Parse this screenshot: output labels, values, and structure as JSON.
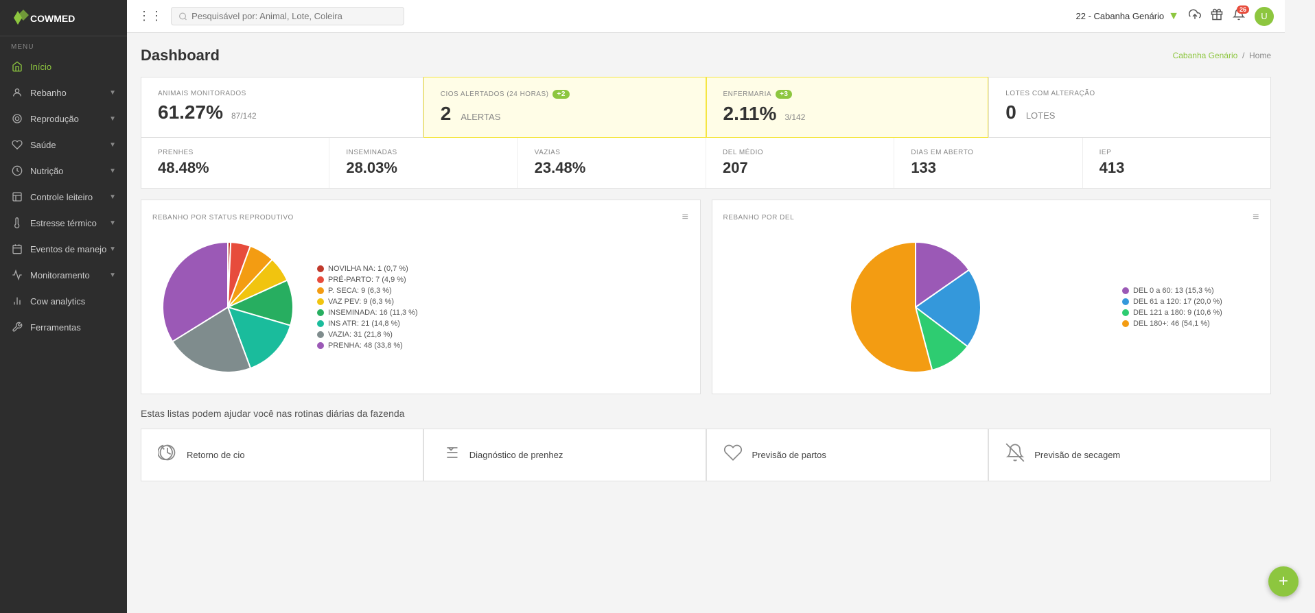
{
  "sidebar": {
    "logo_text": "COWMED",
    "menu_label": "Menu",
    "items": [
      {
        "id": "inicio",
        "label": "Início",
        "icon": "home",
        "active": true,
        "has_children": false
      },
      {
        "id": "rebanho",
        "label": "Rebanho",
        "icon": "cow",
        "active": false,
        "has_children": true
      },
      {
        "id": "reproducao",
        "label": "Reprodução",
        "icon": "circle",
        "active": false,
        "has_children": true
      },
      {
        "id": "saude",
        "label": "Saúde",
        "icon": "heart",
        "active": false,
        "has_children": true
      },
      {
        "id": "nutricao",
        "label": "Nutrição",
        "icon": "leaf",
        "active": false,
        "has_children": true
      },
      {
        "id": "controle_leiteiro",
        "label": "Controle leiteiro",
        "icon": "milk",
        "active": false,
        "has_children": true
      },
      {
        "id": "estresse_termico",
        "label": "Estresse térmico",
        "icon": "therm",
        "active": false,
        "has_children": true
      },
      {
        "id": "eventos_manejo",
        "label": "Eventos de manejo",
        "icon": "calendar",
        "active": false,
        "has_children": true
      },
      {
        "id": "monitoramento",
        "label": "Monitoramento",
        "icon": "monitor",
        "active": false,
        "has_children": true
      },
      {
        "id": "cow_analytics",
        "label": "Cow analytics",
        "icon": "analytics",
        "active": false,
        "has_children": false
      },
      {
        "id": "ferramentas",
        "label": "Ferramentas",
        "icon": "tools",
        "active": false,
        "has_children": false
      }
    ]
  },
  "topbar": {
    "search_placeholder": "Pesquisável por: Animal, Lote, Coleira",
    "location": "22 - Cabanha Genário",
    "notifications_count": "26",
    "avatar_letter": "U"
  },
  "page": {
    "title": "Dashboard",
    "breadcrumb_home": "Home",
    "breadcrumb_link": "Cabanha Genário"
  },
  "stats_row1": {
    "card1": {
      "label": "ANIMAIS MONITORADOS",
      "value": "61.27%",
      "sub": "87/142"
    },
    "card2": {
      "label": "CIOS ALERTADOS (24 HORAS)",
      "badge": "+2",
      "value": "2",
      "sub_label": "ALERTAS"
    },
    "card3": {
      "label": "ENFERMARIA",
      "badge": "+3",
      "value": "2.11%",
      "sub": "3/142"
    },
    "card4": {
      "label": "LOTES COM ALTERAÇÃO",
      "value": "0",
      "sub_label": "LOTES"
    }
  },
  "stats_row2": {
    "prenhes": {
      "label": "PRENHES",
      "value": "48.48%"
    },
    "inseminadas": {
      "label": "INSEMINADAS",
      "value": "28.03%"
    },
    "vazias": {
      "label": "VAZIAS",
      "value": "23.48%"
    },
    "del_medio": {
      "label": "DEL MÉDIO",
      "value": "207"
    },
    "dias_em_aberto": {
      "label": "DIAS EM ABERTO",
      "value": "133"
    },
    "iep": {
      "label": "IEP",
      "value": "413"
    }
  },
  "chart_reprodutivo": {
    "title": "REBANHO POR STATUS REPRODUTIVO",
    "segments": [
      {
        "label": "NOVILHA NA: 1 (0,7 %)",
        "color": "#c0392b",
        "value": 0.7
      },
      {
        "label": "PRÉ-PARTO: 7 (4,9 %)",
        "color": "#e74c3c",
        "value": 4.9
      },
      {
        "label": "P. SECA: 9 (6,3 %)",
        "color": "#f39c12",
        "value": 6.3
      },
      {
        "label": "VAZ PEV: 9 (6,3 %)",
        "color": "#f1c40f",
        "value": 6.3
      },
      {
        "label": "INSEMINADA: 16 (11,3 %)",
        "color": "#27ae60",
        "value": 11.3
      },
      {
        "label": "INS ATR: 21 (14,8 %)",
        "color": "#1abc9c",
        "value": 14.8
      },
      {
        "label": "VAZIA: 31 (21,8 %)",
        "color": "#7f8c8d",
        "value": 21.8
      },
      {
        "label": "PRENHA: 48 (33,8 %)",
        "color": "#9b59b6",
        "value": 33.8
      }
    ]
  },
  "chart_del": {
    "title": "REBANHO POR DEL",
    "segments": [
      {
        "label": "DEL 0 a 60: 13 (15,3 %)",
        "color": "#9b59b6",
        "value": 15.3
      },
      {
        "label": "DEL 61 a 120: 17 (20,0 %)",
        "color": "#3498db",
        "value": 20.0
      },
      {
        "label": "DEL 121 a 180: 9 (10,6 %)",
        "color": "#2ecc71",
        "value": 10.6
      },
      {
        "label": "DEL 180+: 46 (54,1 %)",
        "color": "#f39c12",
        "value": 54.1
      }
    ]
  },
  "bottom": {
    "title": "Estas listas podem ajudar você nas rotinas diárias da fazenda",
    "cards": [
      {
        "id": "retorno_cio",
        "label": "Retorno de cio",
        "icon": "clock"
      },
      {
        "id": "diagnostico_prenhez",
        "label": "Diagnóstico de prenhez",
        "icon": "list-check"
      },
      {
        "id": "previsao_partos",
        "label": "Previsão de partos",
        "icon": "heart"
      },
      {
        "id": "previsao_secagem",
        "label": "Previsão de secagem",
        "icon": "bell-off"
      }
    ]
  }
}
